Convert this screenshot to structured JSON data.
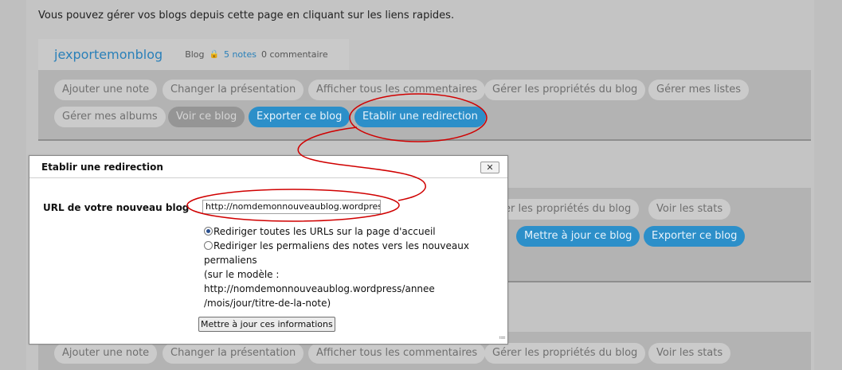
{
  "intro_text": "Vous pouvez gérer vos blogs depuis cette page en cliquant sur les liens rapides.",
  "blog1": {
    "title": "jexportemonblog",
    "type_label": "Blog",
    "notes": "5 notes",
    "comments": "0 commentaire",
    "row1": [
      "Ajouter une note",
      "Changer la présentation",
      "Afficher tous les commentaires",
      "Gérer les propriétés du blog",
      "Gérer mes listes"
    ],
    "row2": {
      "albums": "Gérer mes albums",
      "view": "Voir ce blog",
      "export": "Exporter ce blog",
      "redirect": "Etablir une redirection"
    }
  },
  "blog2": {
    "props": "rer les propriétés du blog",
    "stats": "Voir les stats",
    "update": "Mettre à jour ce blog",
    "export": "Exporter ce blog"
  },
  "blog3": {
    "row1": [
      "Ajouter une note",
      "Changer la présentation",
      "Afficher tous les commentaires",
      "Gérer les propriétés du blog",
      "Voir les stats"
    ]
  },
  "dialog": {
    "title": "Etablir une redirection",
    "close_label": "✕",
    "url_label": "URL de votre nouveau blog",
    "url_value": "http://nomdemonnouveaublog.wordpress",
    "option1": "Rediriger toutes les URLs sur la page d'accueil",
    "option2": "Rediriger les permaliens des notes vers les nouveaux permaliens",
    "model_line1": "(sur le modèle :",
    "model_line2": "http://nomdemonnouveaublog.wordpress/annee",
    "model_line3": "/mois/jour/titre-de-la-note)",
    "submit": "Mettre à jour ces informations"
  },
  "colors": {
    "accent": "#2c8fc9",
    "annotation": "#d00000"
  }
}
